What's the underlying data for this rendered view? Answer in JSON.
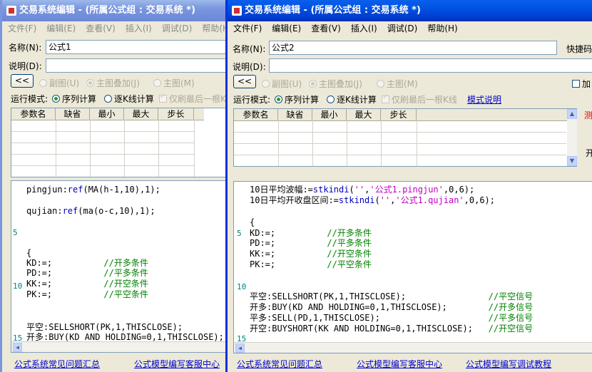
{
  "w1": {
    "title": "交易系统编辑 - (所属公式组 : 交易系统 *)",
    "menu": [
      "文件(F)",
      "编辑(E)",
      "查看(V)",
      "插入(I)",
      "调试(D)",
      "帮助(H)"
    ],
    "name_label": "名称(N):",
    "name_value": "公式1",
    "desc_label": "说明(D):",
    "collapse_btn": "<<",
    "radio_subfig": "副图(U)",
    "radio_overlay": "主图叠加(J)",
    "radio_main": "主图(M)",
    "mode_label": "运行模式:",
    "mode_seq": "序列计算",
    "mode_kline": "逐K线计算",
    "refresh_last": "仅刷最后一根K",
    "param_headers": [
      "参数名",
      "缺省",
      "最小",
      "最大",
      "步长"
    ],
    "code_lines": [
      "pingjun:ref(MA(h-1,10),1);",
      "",
      "qujian:ref(ma(o-c,10),1);",
      "",
      "",
      "",
      "{",
      "KD:=;          //开多条件",
      "PD:=;          //平多条件",
      "KK:=;          //开空条件",
      "PK:=;          //平空条件",
      "",
      "",
      "平空:SELLSHORT(PK,1,THISCLOSE);",
      "开多:BUY(KD AND HOLDING=0,1,THISCLOSE);"
    ],
    "line_numbers": [
      "5",
      "10",
      "15"
    ],
    "footer_links": [
      "公式系统常见问题汇总",
      "公式模型编写客服中心"
    ]
  },
  "w2": {
    "title": "交易系统编辑 - (所属公式组 : 交易系统 *)",
    "menu": [
      "文件(F)",
      "编辑(E)",
      "查看(V)",
      "插入(I)",
      "调试(D)",
      "帮助(H)"
    ],
    "name_label": "名称(N):",
    "name_value": "公式2",
    "shortcut_label": "快捷码",
    "desc_label": "说明(D):",
    "collapse_btn": "<<",
    "radio_subfig": "副图(U)",
    "radio_overlay": "主图叠加(J)",
    "radio_main": "主图(M)",
    "add_label": "加",
    "mode_label": "运行模式:",
    "mode_seq": "序列计算",
    "mode_kline": "逐K线计算",
    "refresh_last": "仅刷最后一根K线",
    "mode_help": "模式说明",
    "param_headers": [
      "参数名",
      "缺省",
      "最小",
      "最大",
      "步长"
    ],
    "side_test": "测",
    "side_open": "开",
    "code_lines": [
      "10日平均波幅:=stkindi('','公式1.pingjun',0,6);",
      "10日平均开收盘区间:=stkindi('','公式1.qujian',0,6);",
      "",
      "{",
      "KD:=;          //开多条件",
      "PD:=;          //平多条件",
      "KK:=;          //开空条件",
      "PK:=;          //平空条件",
      "",
      "",
      "平空:SELLSHORT(PK,1,THISCLOSE);                //平空信号",
      "开多:BUY(KD AND HOLDING=0,1,THISCLOSE);        //开多信号",
      "平多:SELL(PD,1,THISCLOSE);                     //平多信号",
      "开空:BUYSHORT(KK AND HOLDING=0,1,THISCLOSE);   //开空信号"
    ],
    "line_numbers": [
      "5",
      "10",
      "15"
    ],
    "footer_links": [
      "公式系统常见问题汇总",
      "公式模型编写客服中心",
      "公式模型编写调试教程"
    ]
  }
}
